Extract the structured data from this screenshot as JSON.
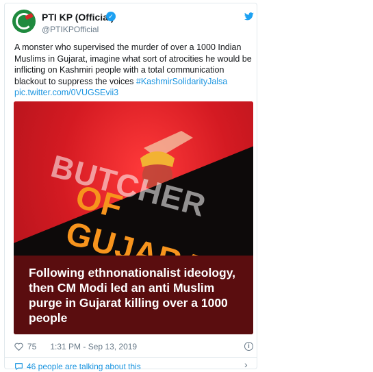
{
  "tweet": {
    "display_name": "PTI KP (Official)",
    "handle": "@PTIKPOfficial",
    "text_main": "A monster who supervised the murder of over a 1000 Indian Muslims in Gujarat, imagine what sort of atrocities he would be inflicting on Kashmiri people with a total communication blackout to suppress the voices ",
    "hashtag": "#KashmirSolidarityJalsa",
    "pic_link": "pic.twitter.com/0VUGSEvii3",
    "likes": "75",
    "timestamp": "1:31 PM - Sep 13, 2019",
    "talking": "46 people are talking about this"
  },
  "media": {
    "headline_1": "BUTCHER",
    "headline_2": "OF GUJARAT",
    "caption": "Following ethnonationalist ideology, then CM Modi led an anti Muslim purge in Gujarat killing over a 1000 people"
  },
  "icons": [
    "verified-badge-icon",
    "twitter-bird-icon",
    "heart-icon",
    "info-icon",
    "comment-bubble-icon",
    "chevron-right-icon"
  ],
  "colors": {
    "link": "#1b95e0",
    "accent_orange": "#f7941d",
    "bg_red": "#e0202a",
    "caption_bg": "#5a0d0f"
  }
}
